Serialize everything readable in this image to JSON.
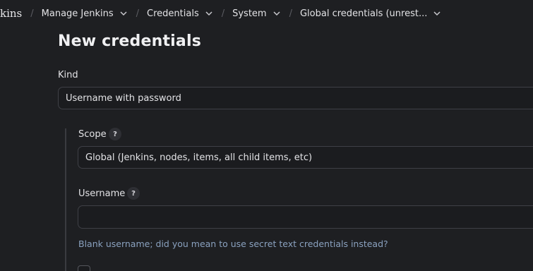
{
  "breadcrumb": {
    "root": "kins",
    "items": [
      {
        "label": "Manage Jenkins"
      },
      {
        "label": "Credentials"
      },
      {
        "label": "System"
      },
      {
        "label": "Global credentials (unrest..."
      }
    ]
  },
  "page": {
    "title": "New credentials"
  },
  "form": {
    "kind_label": "Kind",
    "kind_value": "Username with password",
    "scope_label": "Scope",
    "scope_value": "Global (Jenkins, nodes, items, all child items, etc)",
    "username_label": "Username",
    "username_value": "",
    "help_glyph": "?",
    "username_hint": "Blank username; did you mean to use secret text credentials instead?"
  },
  "icons": {
    "chevron": "chevron-down-icon",
    "help": "help-icon"
  },
  "colors": {
    "background": "#1e1f22",
    "hint": "#8aa1bf",
    "border": "#3f4046"
  }
}
